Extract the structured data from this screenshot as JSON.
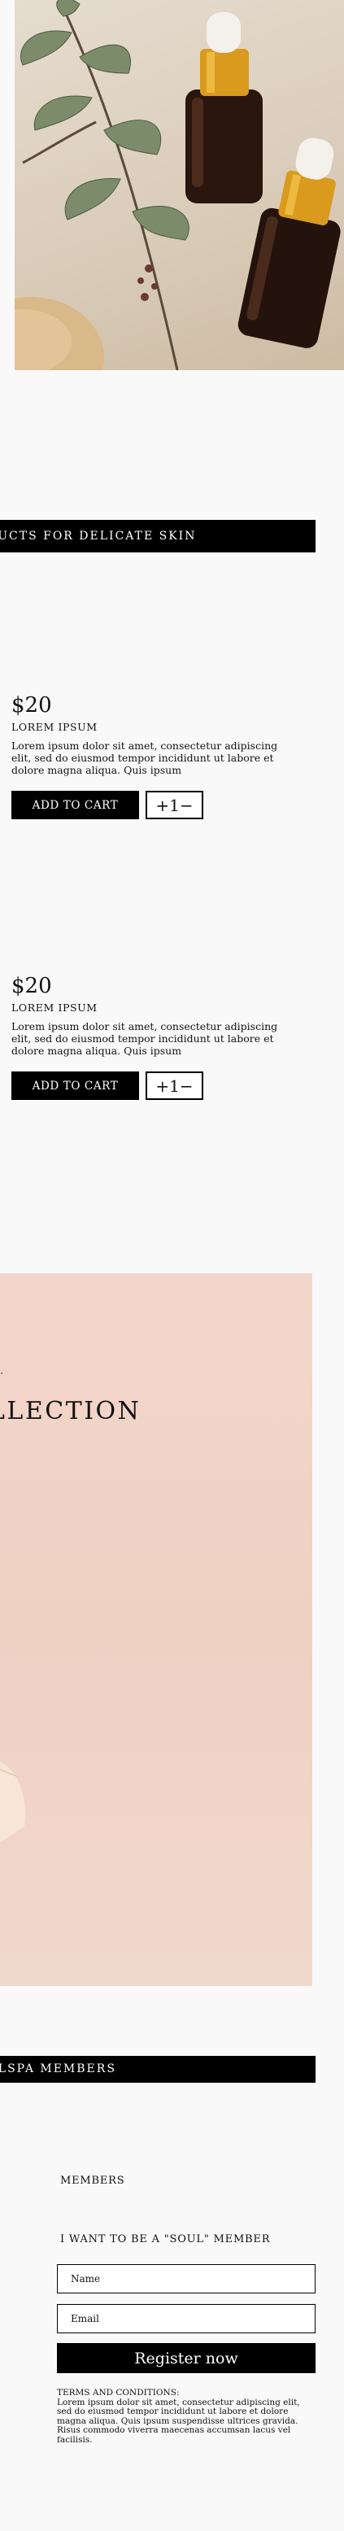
{
  "banner_products": "DUCTS FOR DELICATE SKIN",
  "products": [
    {
      "price": "$20",
      "name": "LOREM IPSUM",
      "description": "Lorem ipsum dolor sit amet, consectetur adipiscing elit, sed do eiusmod tempor incididunt ut labore et dolore magna aliqua. Quis ipsum",
      "cart_label": "ADD TO CART",
      "qty_label": "+1−"
    },
    {
      "price": "$20",
      "name": "LOREM IPSUM",
      "description": "Lorem ipsum dolor sit amet, consectetur adipiscing elit, sed do eiusmod tempor incididunt ut labore et dolore magna aliqua. Quis ipsum",
      "cart_label": "ADD TO CART",
      "qty_label": "+1−"
    }
  ],
  "collection": {
    "mark": "·",
    "title": "LLECTION"
  },
  "banner_members": "ULSPA MEMBERS",
  "members": {
    "heading": "MEMBERS",
    "subheading": "I WANT TO BE A \"SOUL\" MEMBER",
    "name_placeholder": "Name",
    "email_placeholder": "Email",
    "register_label": "Register now",
    "terms_title": "TERMS AND CONDITIONS:",
    "terms_text": "Lorem ipsum dolor sit amet, consectetur adipiscing elit, sed do eiusmod tempor incididunt ut labore et dolore magna aliqua. Quis ipsum suspendisse ultrices gravida. Risus commodo viverra maecenas accumsan lacus vel facilisis."
  },
  "colors": {
    "banner": "#000000",
    "page_background": "#f9f9f9",
    "collection_background": "#f0d4c7",
    "dropper_cap": "#d99a1e"
  }
}
